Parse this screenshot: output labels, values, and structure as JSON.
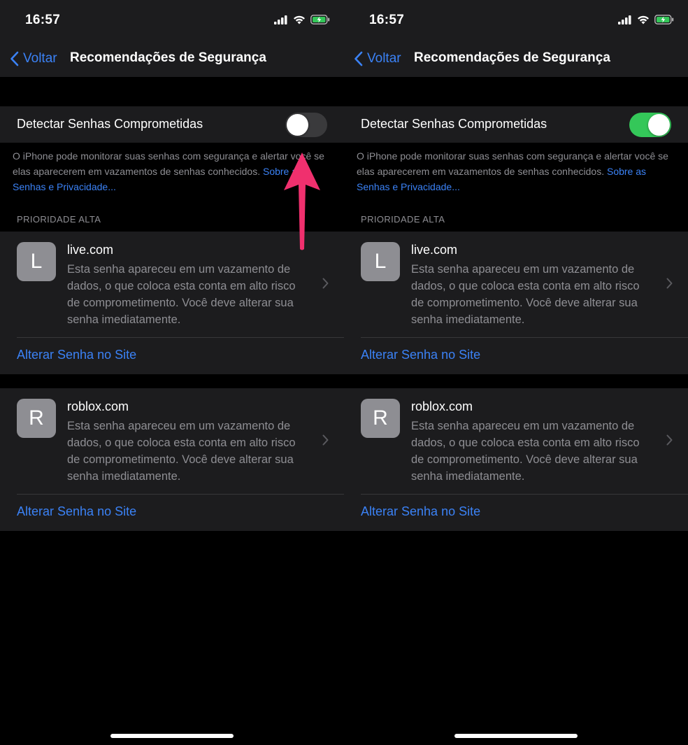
{
  "status": {
    "time": "16:57",
    "icons": [
      "cellular-signal-icon",
      "wifi-icon",
      "battery-charging-icon"
    ]
  },
  "nav": {
    "back_label": "Voltar",
    "title": "Recomendações de Segurança"
  },
  "toggle": {
    "label": "Detectar Senhas Comprometidas"
  },
  "footnote": {
    "text": "O iPhone pode monitorar suas senhas com segurança e alertar você se elas aparecerem em vazamentos de senhas conhecidos.",
    "link": "Sobre as Senhas e Privacidade..."
  },
  "section_header": "PRIORIDADE ALTA",
  "accounts": [
    {
      "initial": "L",
      "site": "live.com",
      "description": "Esta senha apareceu em um vazamento de dados, o que coloca esta conta em alto risco de comprometimento. Você deve alterar sua senha imediatamente.",
      "action": "Alterar Senha no Site"
    },
    {
      "initial": "R",
      "site": "roblox.com",
      "description": "Esta senha apareceu em um vazamento de dados, o que coloca esta conta em alto risco de comprometimento. Você deve alterar sua senha imediatamente.",
      "action": "Alterar Senha no Site"
    }
  ],
  "screens": [
    {
      "toggle_on": false
    },
    {
      "toggle_on": true
    }
  ],
  "colors": {
    "accent_blue": "#3b82f6",
    "switch_on": "#34c759",
    "switch_off": "#3a3a3c",
    "arrow_pink": "#f0306e",
    "cell_background": "#1c1c1e"
  }
}
